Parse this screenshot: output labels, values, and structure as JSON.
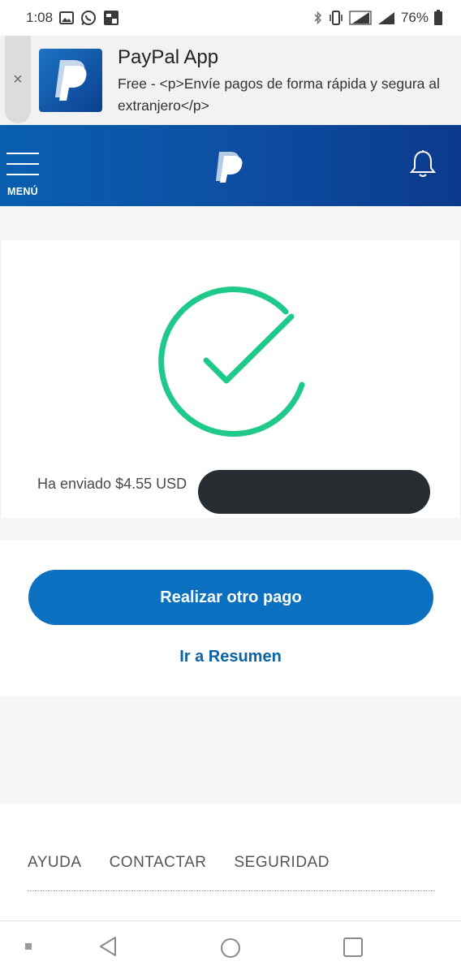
{
  "status_bar": {
    "time": "1:08",
    "battery": "76%",
    "icons": [
      "image-icon",
      "whatsapp-icon",
      "sim-notification-icon",
      "bluetooth-icon",
      "vibrate-icon",
      "signal-4g-icon",
      "signal-4g-icon",
      "battery-icon"
    ]
  },
  "banner": {
    "app_name": "PayPal App",
    "description": "Free - <p>Envíe pagos de forma rápida y segura al extranjero</p>",
    "close_symbol": "×"
  },
  "header": {
    "menu_label": "MENÚ"
  },
  "confirmation": {
    "sent_text": "Ha enviado $4.55 USD",
    "colors": {
      "check": "#1ec98a"
    }
  },
  "actions": {
    "primary_label": "Realizar otro pago",
    "secondary_label": "Ir a Resumen"
  },
  "footer": {
    "links": [
      "AYUDA",
      "CONTACTAR",
      "SEGURIDAD"
    ]
  },
  "colors": {
    "brand_blue": "#0b70bf",
    "header_blue": "#0d4fa3",
    "link_blue": "#0b63a8"
  }
}
